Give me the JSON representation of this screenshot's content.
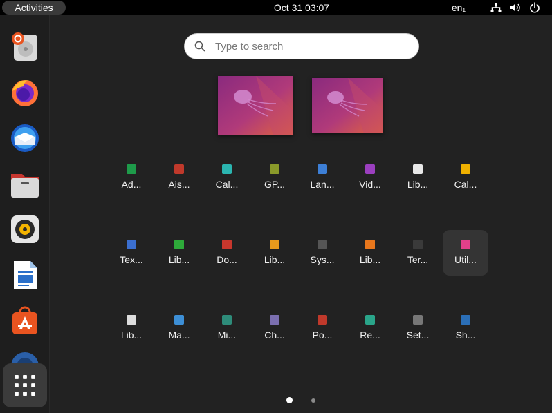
{
  "topbar": {
    "activities_label": "Activities",
    "clock": "Oct 31  03:07",
    "keyboard_lang": "en₁",
    "tray_icons": [
      "network-icon",
      "volume-icon",
      "power-icon"
    ]
  },
  "dock": {
    "items": [
      {
        "name": "ubuntu-installer-icon"
      },
      {
        "name": "firefox-icon"
      },
      {
        "name": "thunderbird-icon"
      },
      {
        "name": "files-icon"
      },
      {
        "name": "rhythmbox-icon"
      },
      {
        "name": "libreoffice-writer-icon"
      },
      {
        "name": "software-icon"
      },
      {
        "name": "help-icon"
      }
    ],
    "show_apps_icon": "apps-grid-icon"
  },
  "search": {
    "placeholder": "Type to search"
  },
  "apps": [
    {
      "label": "Ad...",
      "color": "#1e9b4a"
    },
    {
      "label": "Ais...",
      "color": "#c0392b"
    },
    {
      "label": "Cal...",
      "color": "#2bb5b0"
    },
    {
      "label": "GP...",
      "color": "#8a9a2a"
    },
    {
      "label": "Lan...",
      "color": "#3d7fd6"
    },
    {
      "label": "Vid...",
      "color": "#9b3fbf"
    },
    {
      "label": "Lib...",
      "color": "#e8e8e8"
    },
    {
      "label": "Cal...",
      "color": "#f0b100"
    },
    {
      "label": "Tex...",
      "color": "#3b6fd0"
    },
    {
      "label": "Lib...",
      "color": "#2eaa3a"
    },
    {
      "label": "Do...",
      "color": "#c8372d"
    },
    {
      "label": "Lib...",
      "color": "#e89a1c"
    },
    {
      "label": "Sys...",
      "color": "#555555"
    },
    {
      "label": "Lib...",
      "color": "#e8771c"
    },
    {
      "label": "Ter...",
      "color": "#3a3a3a"
    },
    {
      "label": "Util...",
      "color": "#e0408a"
    },
    {
      "label": "Lib...",
      "color": "#dddddd"
    },
    {
      "label": "Ma...",
      "color": "#3d8fd6"
    },
    {
      "label": "Mi...",
      "color": "#2e8c7a"
    },
    {
      "label": "Ch...",
      "color": "#7b6fb0"
    },
    {
      "label": "Po...",
      "color": "#c0392b"
    },
    {
      "label": "Re...",
      "color": "#2aa58a"
    },
    {
      "label": "Set...",
      "color": "#777777"
    },
    {
      "label": "Sh...",
      "color": "#2b6fb8"
    }
  ],
  "pages": {
    "current": 1,
    "total": 2
  },
  "colors": {
    "accent": "#e95420",
    "panel": "#000000",
    "background": "#222222"
  }
}
